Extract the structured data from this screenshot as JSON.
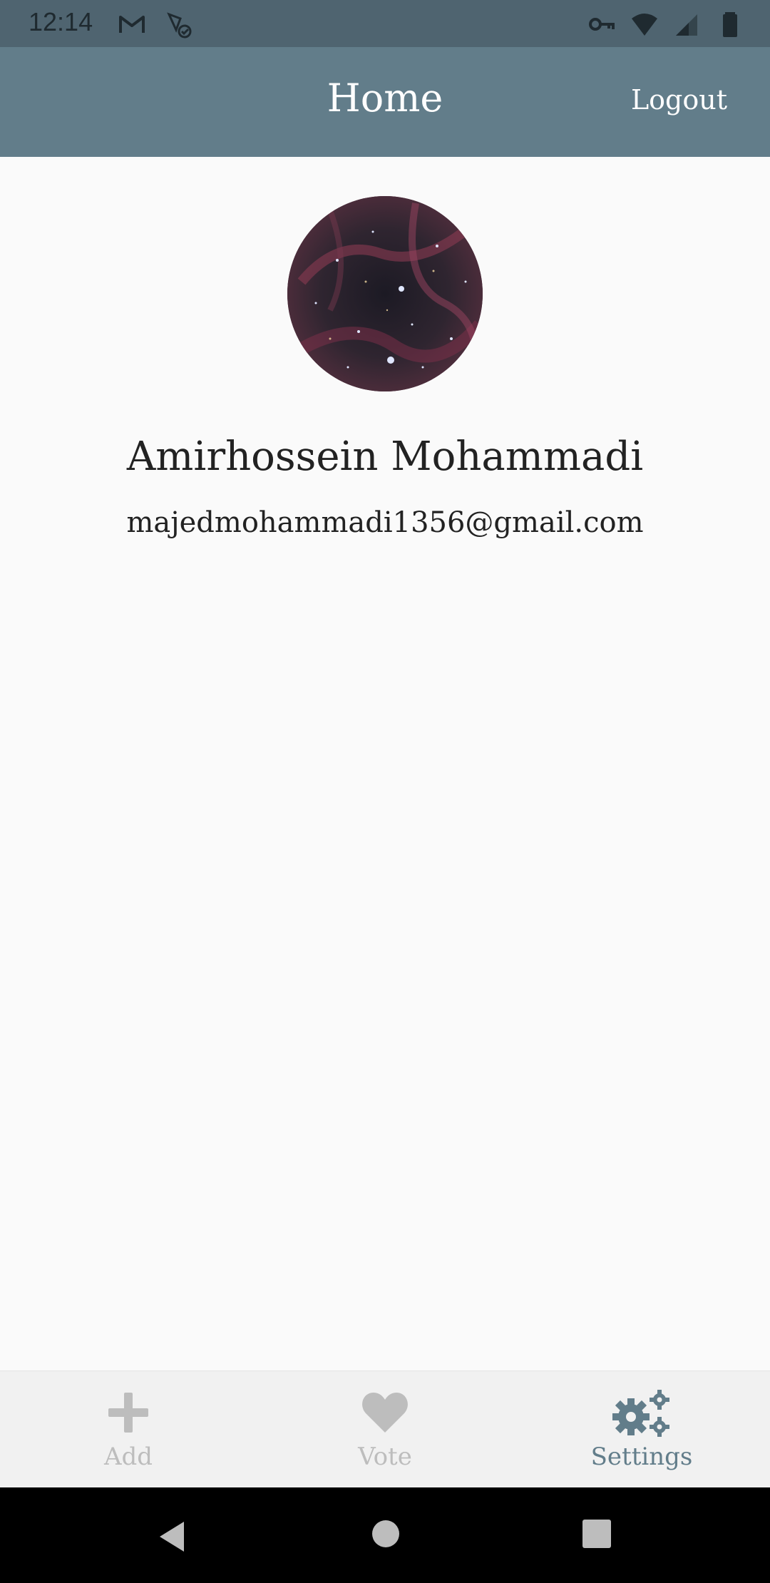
{
  "status_bar": {
    "time": "12:14",
    "icons_left": [
      "gmail-icon",
      "satellite-icon"
    ],
    "icons_right": [
      "vpn-key-icon",
      "wifi-icon",
      "signal-icon",
      "battery-icon"
    ]
  },
  "app_bar": {
    "title": "Home",
    "logout_label": "Logout",
    "background": "#627d8a"
  },
  "profile": {
    "name": "Amirhossein Mohammadi",
    "email": "majedmohammadi1356@gmail.com"
  },
  "bottom_nav": {
    "items": [
      {
        "label": "Add",
        "icon": "plus-icon",
        "active": false
      },
      {
        "label": "Vote",
        "icon": "heart-icon",
        "active": false
      },
      {
        "label": "Settings",
        "icon": "gears-icon",
        "active": true
      }
    ],
    "active_color": "#627d8a",
    "inactive_color": "#bdbdbd"
  },
  "system_nav": {
    "icons": [
      "back-icon",
      "home-icon",
      "recents-icon"
    ]
  }
}
